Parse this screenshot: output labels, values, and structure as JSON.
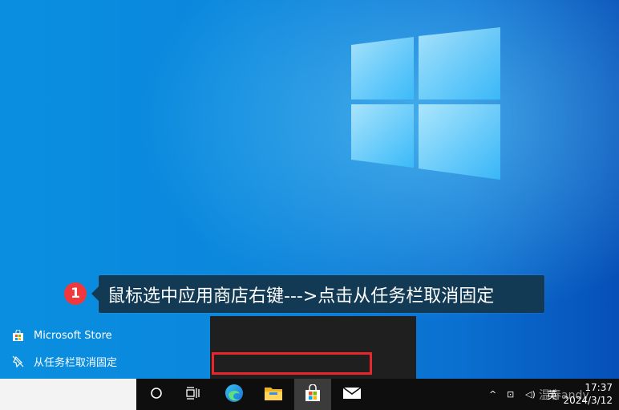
{
  "annotation": {
    "step": "1",
    "text": "鼠标选中应用商店右键--->点击从任务栏取消固定"
  },
  "context_menu": {
    "items": [
      {
        "label": "Microsoft Store",
        "icon": "store-icon"
      },
      {
        "label": "从任务栏取消固定",
        "icon": "unpin-icon"
      }
    ]
  },
  "taskbar": {
    "apps": [
      {
        "name": "cortana",
        "icon": "circle-icon"
      },
      {
        "name": "task-view",
        "icon": "task-view-icon"
      },
      {
        "name": "edge",
        "icon": "edge-icon"
      },
      {
        "name": "file-explorer",
        "icon": "folder-icon"
      },
      {
        "name": "microsoft-store",
        "icon": "store-icon"
      },
      {
        "name": "mail",
        "icon": "mail-icon"
      }
    ],
    "tray": {
      "chevron": "^",
      "network": "⊡",
      "volume": "◁)",
      "ime": "英"
    },
    "clock": {
      "time": "17:37",
      "date": "2024/3/12"
    }
  },
  "watermark": "温春andy",
  "colors": {
    "accent_red": "#e8262c",
    "badge_red": "#f0393d",
    "annotation_bg": "#123a55",
    "menu_bg": "#1f1f1f",
    "taskbar_bg": "#0e0e0e"
  }
}
